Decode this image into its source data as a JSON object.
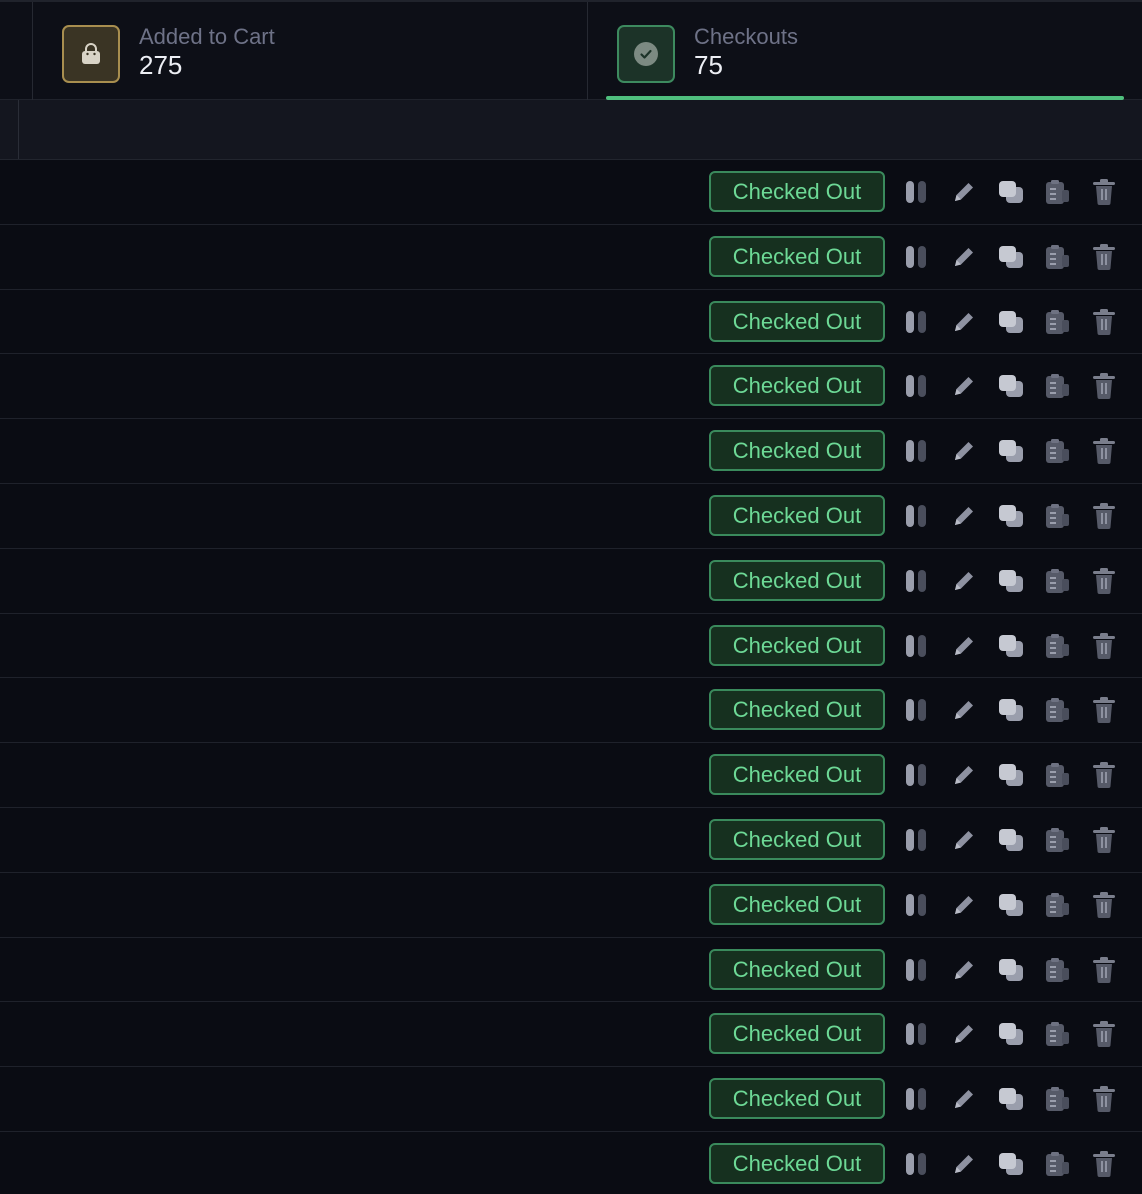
{
  "stats": {
    "cart": {
      "label": "Added to Cart",
      "value": "275",
      "icon": "shopping-bag-icon"
    },
    "checkouts": {
      "label": "Checkouts",
      "value": "75",
      "icon": "check-circle-icon",
      "active": true
    }
  },
  "colors": {
    "background": "#0a0c13",
    "accent_green": "#4fbf7e",
    "badge_text": "#6dd996",
    "cart_accent": "#a88e4f",
    "icon_gray": "#5f6373"
  },
  "rows": [
    {
      "status": "Checked Out"
    },
    {
      "status": "Checked Out"
    },
    {
      "status": "Checked Out"
    },
    {
      "status": "Checked Out"
    },
    {
      "status": "Checked Out"
    },
    {
      "status": "Checked Out"
    },
    {
      "status": "Checked Out"
    },
    {
      "status": "Checked Out"
    },
    {
      "status": "Checked Out"
    },
    {
      "status": "Checked Out"
    },
    {
      "status": "Checked Out"
    },
    {
      "status": "Checked Out"
    },
    {
      "status": "Checked Out"
    },
    {
      "status": "Checked Out"
    },
    {
      "status": "Checked Out"
    },
    {
      "status": "Checked Out"
    }
  ],
  "row_actions": [
    "pause-icon",
    "pencil-icon",
    "copy-icon",
    "clipboard-icon",
    "trash-icon"
  ]
}
